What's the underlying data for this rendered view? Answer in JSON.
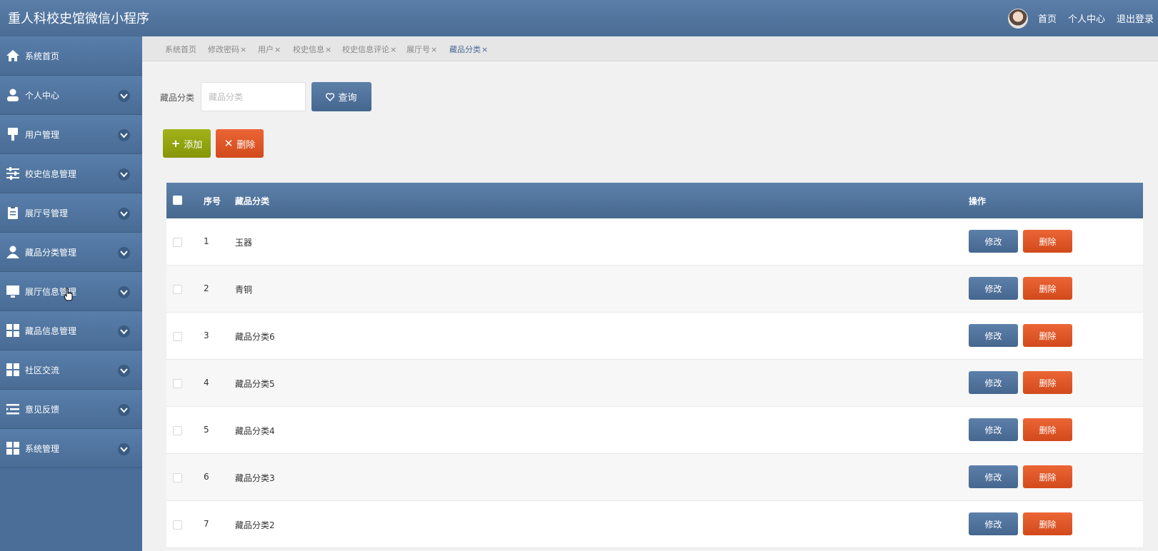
{
  "header": {
    "title": "重人科校史馆微信小程序",
    "links": [
      "首页",
      "个人中心",
      "退出登录"
    ]
  },
  "sidebar": {
    "items": [
      {
        "label": "系统首页",
        "icon": "home-icon",
        "expandable": false
      },
      {
        "label": "个人中心",
        "icon": "user-icon",
        "expandable": true
      },
      {
        "label": "用户管理",
        "icon": "brush-icon",
        "expandable": true
      },
      {
        "label": "校史信息管理",
        "icon": "sliders-icon",
        "expandable": true
      },
      {
        "label": "展厅号管理",
        "icon": "clipboard-icon",
        "expandable": true
      },
      {
        "label": "藏品分类管理",
        "icon": "person-icon",
        "expandable": true
      },
      {
        "label": "展厅信息管理",
        "icon": "monitor-icon",
        "expandable": true
      },
      {
        "label": "藏品信息管理",
        "icon": "grid-icon",
        "expandable": true
      },
      {
        "label": "社区交流",
        "icon": "grid-icon",
        "expandable": true
      },
      {
        "label": "意见反馈",
        "icon": "list-icon",
        "expandable": true
      },
      {
        "label": "系统管理",
        "icon": "grid-icon",
        "expandable": true
      }
    ]
  },
  "tabs": [
    {
      "label": "系统首页",
      "closable": false
    },
    {
      "label": "修改密码",
      "closable": true
    },
    {
      "label": "用户",
      "closable": true
    },
    {
      "label": "校史信息",
      "closable": true
    },
    {
      "label": "校史信息评论",
      "closable": true
    },
    {
      "label": "展厅号",
      "closable": true
    },
    {
      "label": "藏品分类",
      "closable": true,
      "active": true
    }
  ],
  "tab_close": "×",
  "search": {
    "label": "藏品分类",
    "placeholder": "藏品分类",
    "button": "查询"
  },
  "actions": {
    "add": "添加",
    "add_symbol": "+",
    "delete": "删除",
    "delete_symbol": "✕"
  },
  "table": {
    "columns": [
      "序号",
      "藏品分类",
      "操作"
    ],
    "rows": [
      {
        "idx": "1",
        "name": "玉器"
      },
      {
        "idx": "2",
        "name": "青铜"
      },
      {
        "idx": "3",
        "name": "藏品分类6"
      },
      {
        "idx": "4",
        "name": "藏品分类5"
      },
      {
        "idx": "5",
        "name": "藏品分类4"
      },
      {
        "idx": "6",
        "name": "藏品分类3"
      },
      {
        "idx": "7",
        "name": "藏品分类2"
      }
    ],
    "edit_label": "修改",
    "delete_label": "删除"
  },
  "colors": {
    "primary": "#4a6c95",
    "add": "#95a510",
    "danger": "#e0582a"
  }
}
